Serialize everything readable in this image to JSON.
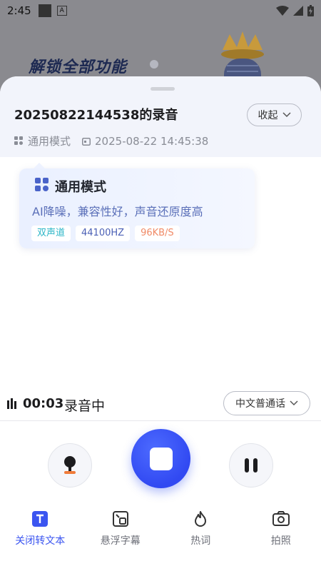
{
  "status_bar": {
    "time": "2:45",
    "notification_letter": "A"
  },
  "background": {
    "promo_text": "解锁全部功能"
  },
  "sheet": {
    "title": "20250822144538的录音",
    "collapse_label": "收起",
    "mode_label": "通用模式",
    "datetime": "2025-08-22 14:45:38"
  },
  "mode_popover": {
    "title": "通用模式",
    "description": "AI降噪，兼容性好，声音还原度高",
    "tags": [
      "双声道",
      "44100HZ",
      "96KB/S"
    ]
  },
  "recorder": {
    "elapsed": "00:03",
    "state": "录音中",
    "language": "中文普通话"
  },
  "tabs": [
    {
      "label": "关闭转文本",
      "icon": "text-t-icon",
      "active": true
    },
    {
      "label": "悬浮字幕",
      "icon": "floating-caption-icon",
      "active": false
    },
    {
      "label": "热词",
      "icon": "flame-icon",
      "active": false
    },
    {
      "label": "拍照",
      "icon": "camera-icon",
      "active": false
    }
  ],
  "colors": {
    "accent": "#3b55f0",
    "record_button": "#3149f2",
    "tag_stereo": "#2db6c7",
    "tag_rate": "#4a5fb5",
    "tag_bitrate": "#f08a66"
  }
}
